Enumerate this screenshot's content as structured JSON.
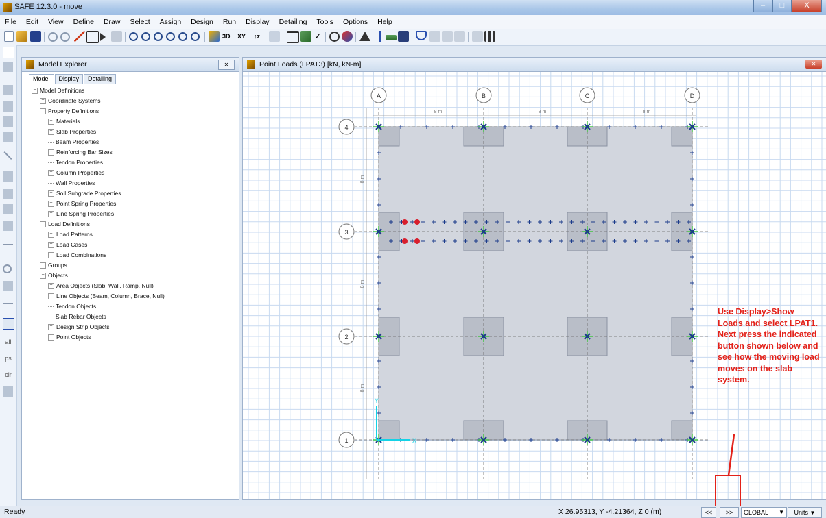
{
  "window": {
    "title": "SAFE 12.3.0 - move",
    "min": "–",
    "max": "□",
    "close": "X"
  },
  "menu": [
    "File",
    "Edit",
    "View",
    "Define",
    "Draw",
    "Select",
    "Assign",
    "Design",
    "Run",
    "Display",
    "Detailing",
    "Tools",
    "Options",
    "Help"
  ],
  "toolbar": {
    "view_3d": "3D",
    "view_xy": "XY",
    "view_z": "↑z"
  },
  "left_toolbar": {
    "all": "all",
    "ps": "ps",
    "clr": "clr"
  },
  "explorer": {
    "title": "Model Explorer",
    "close": "✕",
    "tabs": [
      "Model",
      "Display",
      "Detailing"
    ],
    "tree": [
      {
        "label": "Model Definitions",
        "level": 0,
        "pm": "−"
      },
      {
        "label": "Coordinate Systems",
        "level": 1,
        "pm": "+"
      },
      {
        "label": "Property Definitions",
        "level": 1,
        "pm": "−"
      },
      {
        "label": "Materials",
        "level": 2,
        "pm": "+"
      },
      {
        "label": "Slab Properties",
        "level": 2,
        "pm": "+"
      },
      {
        "label": "Beam Properties",
        "level": 2,
        "pm": ""
      },
      {
        "label": "Reinforcing Bar Sizes",
        "level": 2,
        "pm": "+"
      },
      {
        "label": "Tendon Properties",
        "level": 2,
        "pm": ""
      },
      {
        "label": "Column Properties",
        "level": 2,
        "pm": "+"
      },
      {
        "label": "Wall Properties",
        "level": 2,
        "pm": ""
      },
      {
        "label": "Soil Subgrade Properties",
        "level": 2,
        "pm": "+"
      },
      {
        "label": "Point Spring Properties",
        "level": 2,
        "pm": "+"
      },
      {
        "label": "Line Spring Properties",
        "level": 2,
        "pm": "+"
      },
      {
        "label": "Load Definitions",
        "level": 1,
        "pm": "−"
      },
      {
        "label": "Load Patterns",
        "level": 2,
        "pm": "+"
      },
      {
        "label": "Load Cases",
        "level": 2,
        "pm": "+"
      },
      {
        "label": "Load Combinations",
        "level": 2,
        "pm": "+"
      },
      {
        "label": "Groups",
        "level": 1,
        "pm": "+"
      },
      {
        "label": "Objects",
        "level": 1,
        "pm": "−"
      },
      {
        "label": "Area Objects (Slab, Wall, Ramp, Null)",
        "level": 2,
        "pm": "+"
      },
      {
        "label": "Line Objects (Beam, Column, Brace, Null)",
        "level": 2,
        "pm": "+"
      },
      {
        "label": "Tendon Objects",
        "level": 2,
        "pm": ""
      },
      {
        "label": "Slab Rebar Objects",
        "level": 2,
        "pm": ""
      },
      {
        "label": "Design Strip Objects",
        "level": 2,
        "pm": "+"
      },
      {
        "label": "Point Objects",
        "level": 2,
        "pm": "+"
      }
    ]
  },
  "viewport": {
    "title": "Point Loads (LPAT3)  [kN, kN-m]",
    "close": "✕"
  },
  "grid": {
    "x_labels": [
      "A",
      "B",
      "C",
      "D"
    ],
    "y_labels": [
      "4",
      "3",
      "2",
      "1"
    ],
    "x_dims": [
      "8 m",
      "8 m",
      "8 m"
    ],
    "y_dims": [
      "8 m",
      "8 m",
      "8 m"
    ],
    "axis_x": "X",
    "axis_y": "Y"
  },
  "colors": {
    "annotation": "#e32119",
    "slab": "#d2d6de",
    "grid_line": "#c8daf0",
    "load_dot": "#d81e2c",
    "node": "#1a3a8a",
    "node_cross": "#39c639"
  },
  "annotation": {
    "text": "Use Display>Show Loads and select LPAT1. Next press the indicated button shown below and see how the moving load moves on the slab system."
  },
  "status": {
    "ready": "Ready",
    "coords": "X 26.95313,  Y -4.21364,  Z 0  (m)",
    "prev_button": "<<",
    "next_button": ">>",
    "coord_system": "GLOBAL",
    "units_button": "Units"
  }
}
